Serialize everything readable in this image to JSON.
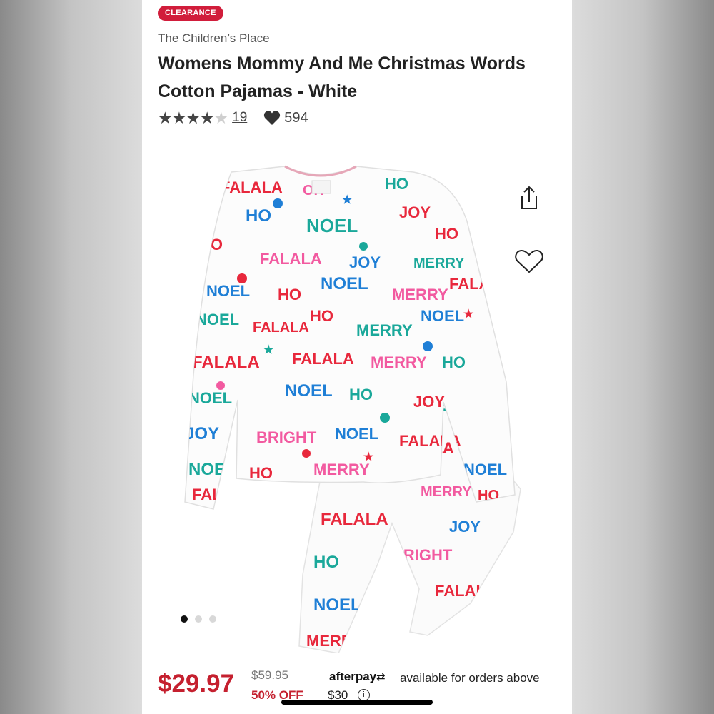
{
  "badge": {
    "label": "CLEARANCE"
  },
  "product": {
    "brand": "The Children’s Place",
    "title": "Womens Mommy And Me Christmas Words Cotton Pajamas - White"
  },
  "rating": {
    "stars": 4,
    "max_stars": 5,
    "review_count": "19",
    "favorites": "594"
  },
  "icons": {
    "share": "share-icon",
    "wishlist": "heart-outline-icon",
    "favorites": "heart-filled-icon",
    "info": "info-icon"
  },
  "pajama_words": [
    "HO",
    "NOEL",
    "FALALA",
    "MERRY",
    "JOY",
    "BRIGHT",
    "OH"
  ],
  "carousel": {
    "total": 3,
    "active": 0
  },
  "pricing": {
    "price": "$29.97",
    "original_price": "$59.95",
    "discount": "50% OFF"
  },
  "afterpay": {
    "logo": "afterpay",
    "text": "available for orders above",
    "amount": "$30",
    "info_symbol": "i"
  },
  "colors": {
    "clearance_badge": "#d11d3b",
    "price": "#c5202f",
    "print_red": "#e8283c",
    "print_pink": "#f25aa0",
    "print_blue": "#1f7fd6",
    "print_teal": "#1aa89a"
  }
}
